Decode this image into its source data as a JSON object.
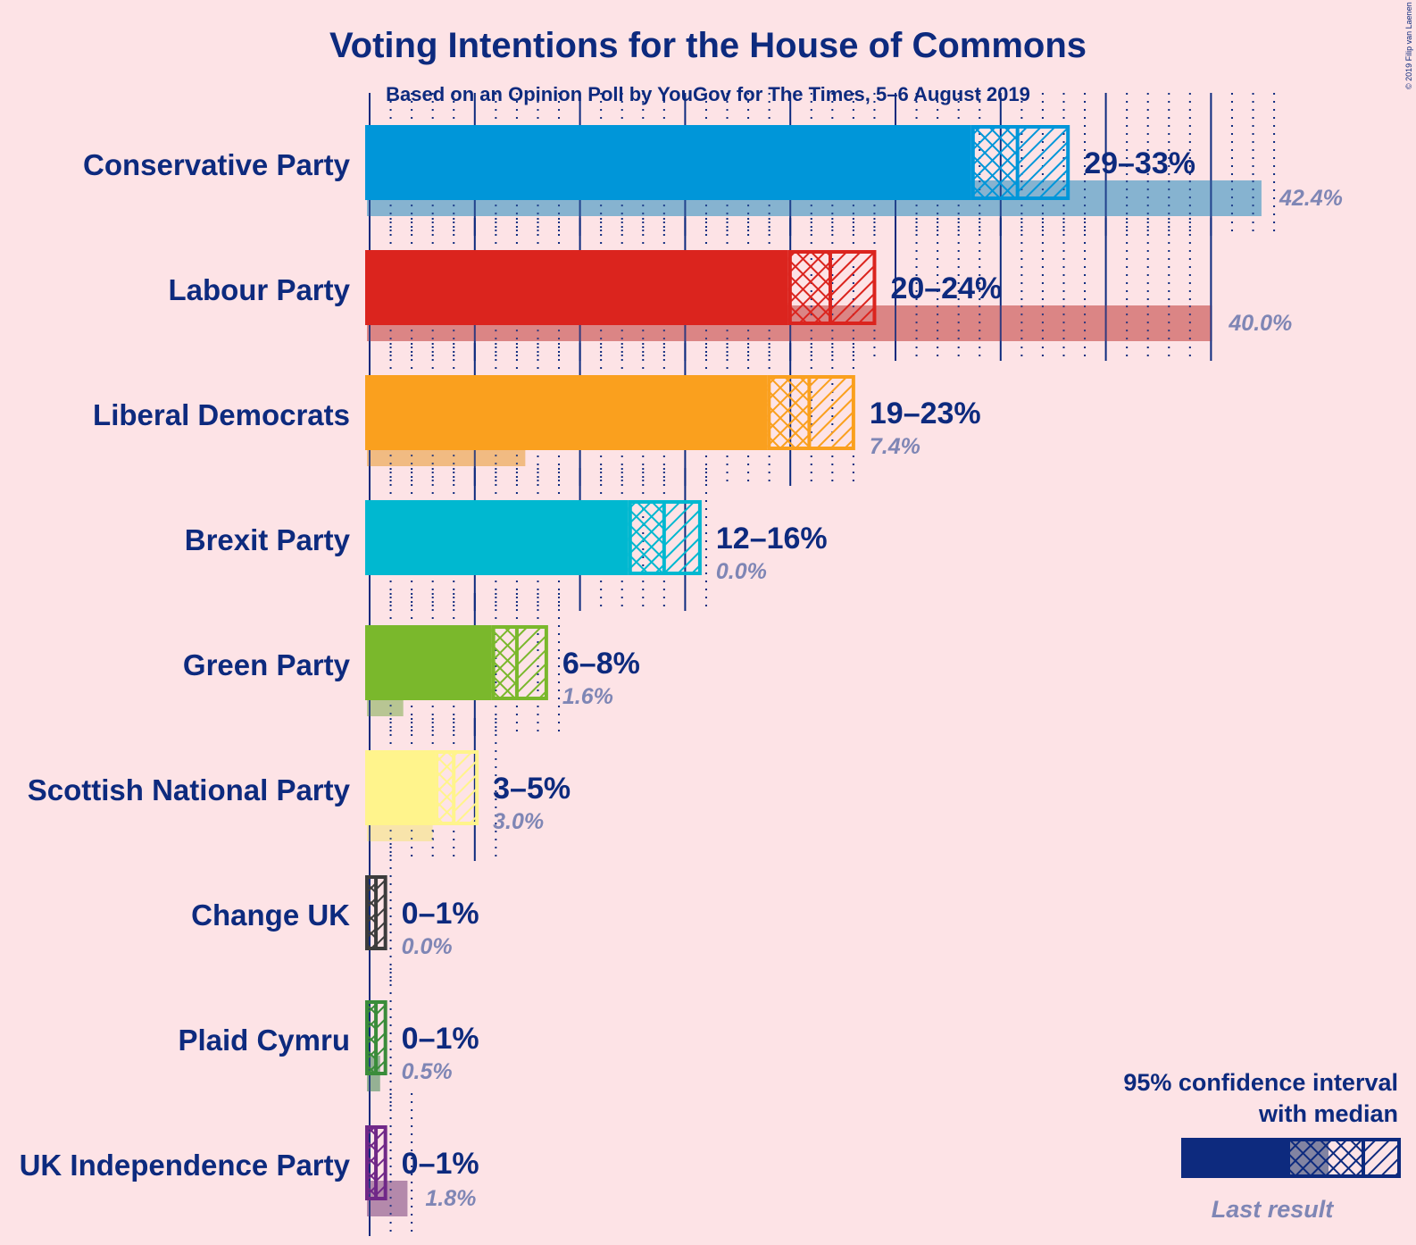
{
  "chart_data": {
    "type": "bar",
    "orientation": "horizontal",
    "title": "Voting Intentions for the House of Commons",
    "subtitle": "Based on an Opinion Poll by YouGov for The Times, 5–6 August 2019",
    "copyright": "© 2019 Filip van Laenen",
    "xlabel": "",
    "ylabel": "",
    "x_unit": "%",
    "xlim": [
      0,
      45
    ],
    "grid": {
      "major_every": 5,
      "minor_every": 1,
      "style_major": "solid",
      "style_minor": "dotted"
    },
    "categories": [
      "Conservative Party",
      "Labour Party",
      "Liberal Democrats",
      "Brexit Party",
      "Green Party",
      "Scottish National Party",
      "Change UK",
      "Plaid Cymru",
      "UK Independence Party"
    ],
    "series": [
      {
        "name": "Conservative Party",
        "color": "#0096d9",
        "last_color": "#80b0cf",
        "ci_low": 28.6,
        "median": 30.8,
        "ci_high": 33.2,
        "range_label": "29–33%",
        "last_result": 42.4,
        "last_label": "42.4%"
      },
      {
        "name": "Labour Party",
        "color": "#db241e",
        "last_color": "#d98080",
        "ci_low": 19.9,
        "median": 21.9,
        "ci_high": 24.0,
        "range_label": "20–24%",
        "last_result": 40.0,
        "last_label": "40.0%"
      },
      {
        "name": "Liberal Democrats",
        "color": "#faa01e",
        "last_color": "#f0b87c",
        "ci_low": 18.9,
        "median": 20.9,
        "ci_high": 23.0,
        "range_label": "19–23%",
        "last_result": 7.4,
        "last_label": "7.4%"
      },
      {
        "name": "Brexit Party",
        "color": "#00b8d0",
        "last_color": "#80c8d8",
        "ci_low": 12.3,
        "median": 14.0,
        "ci_high": 15.7,
        "range_label": "12–16%",
        "last_result": 0.0,
        "last_label": "0.0%"
      },
      {
        "name": "Green Party",
        "color": "#7ab82c",
        "last_color": "#b4c38e",
        "ci_low": 5.8,
        "median": 7.0,
        "ci_high": 8.4,
        "range_label": "6–8%",
        "last_result": 1.6,
        "last_label": "1.6%"
      },
      {
        "name": "Scottish National Party",
        "color": "#fff48c",
        "last_color": "#f8e4a8",
        "ci_low": 3.1,
        "median": 4.0,
        "ci_high": 5.1,
        "range_label": "3–5%",
        "last_result": 3.0,
        "last_label": "3.0%"
      },
      {
        "name": "Change UK",
        "color": "#3c3c3c",
        "last_color": "#8c8c8c",
        "ci_low": 0.0,
        "median": 0.3,
        "ci_high": 0.75,
        "range_label": "0–1%",
        "last_result": 0.0,
        "last_label": "0.0%"
      },
      {
        "name": "Plaid Cymru",
        "color": "#3a8c3a",
        "last_color": "#8fae8f",
        "ci_low": 0.0,
        "median": 0.3,
        "ci_high": 0.75,
        "range_label": "0–1%",
        "last_result": 0.5,
        "last_label": "0.5%"
      },
      {
        "name": "UK Independence Party",
        "color": "#702888",
        "last_color": "#b084a8",
        "ci_low": 0.0,
        "median": 0.3,
        "ci_high": 0.75,
        "range_label": "0–1%",
        "last_result": 1.8,
        "last_label": "1.8%"
      }
    ],
    "legend": {
      "placement": "bottom-right",
      "line1": "95% confidence interval",
      "line2": "with median",
      "last_result_label": "Last result",
      "color": "#0d2a7e",
      "last_color": "#8284a2"
    }
  },
  "colors": {
    "text": "#0d2a7e",
    "background": "#fde3e6",
    "last_text": "#7f86b5"
  }
}
